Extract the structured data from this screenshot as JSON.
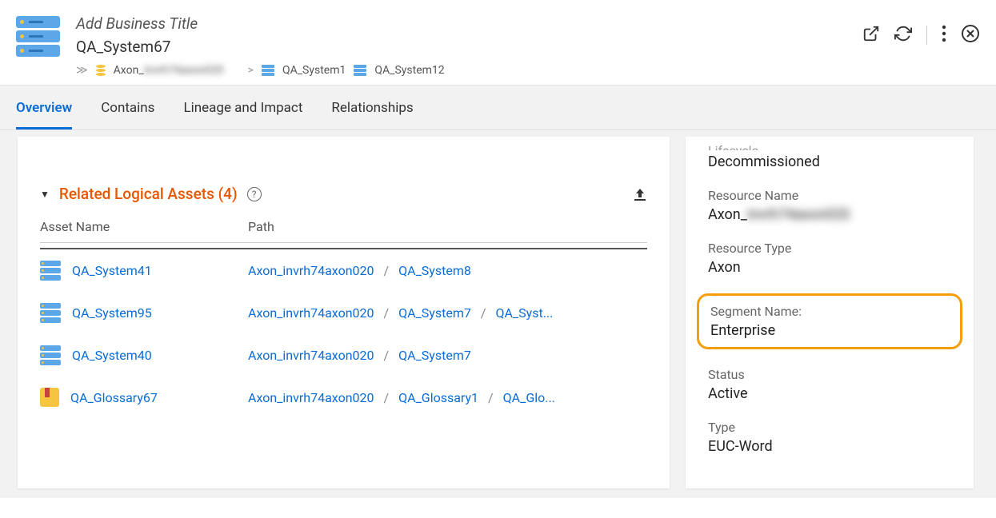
{
  "header": {
    "business_title_placeholder": "Add Business Title",
    "system_name": "QA_System67",
    "breadcrumb": {
      "root_prefix": "Axon_",
      "root_blurred": "invrh74axon020",
      "item1": "QA_System1",
      "item2": "QA_System12"
    }
  },
  "tabs": {
    "overview": "Overview",
    "contains": "Contains",
    "lineage": "Lineage and Impact",
    "relationships": "Relationships"
  },
  "section": {
    "title": "Related Logical Assets (4)",
    "col_asset": "Asset Name",
    "col_path": "Path",
    "rows": [
      {
        "asset": "QA_System41",
        "p1": "Axon_invrh74axon020",
        "p2": "QA_System8",
        "p3": null,
        "icon": "server"
      },
      {
        "asset": "QA_System95",
        "p1": "Axon_invrh74axon020",
        "p2": "QA_System7",
        "p3": "QA_Syst...",
        "icon": "server"
      },
      {
        "asset": "QA_System40",
        "p1": "Axon_invrh74axon020",
        "p2": "QA_System7",
        "p3": null,
        "icon": "server"
      },
      {
        "asset": "QA_Glossary67",
        "p1": "Axon_invrh74axon020",
        "p2": "QA_Glossary1",
        "p3": "QA_Glo...",
        "icon": "glossary"
      }
    ]
  },
  "sidebar": {
    "lifecycle_label_cut": "Lifecycle",
    "lifecycle_value": "Decommissioned",
    "resource_name_label": "Resource Name",
    "resource_name_prefix": "Axon_",
    "resource_name_blurred": "invrh74axon020",
    "resource_type_label": "Resource Type",
    "resource_type_value": "Axon",
    "segment_name_label": "Segment Name:",
    "segment_name_value": "Enterprise",
    "status_label": "Status",
    "status_value": "Active",
    "type_label": "Type",
    "type_value": "EUC-Word"
  }
}
